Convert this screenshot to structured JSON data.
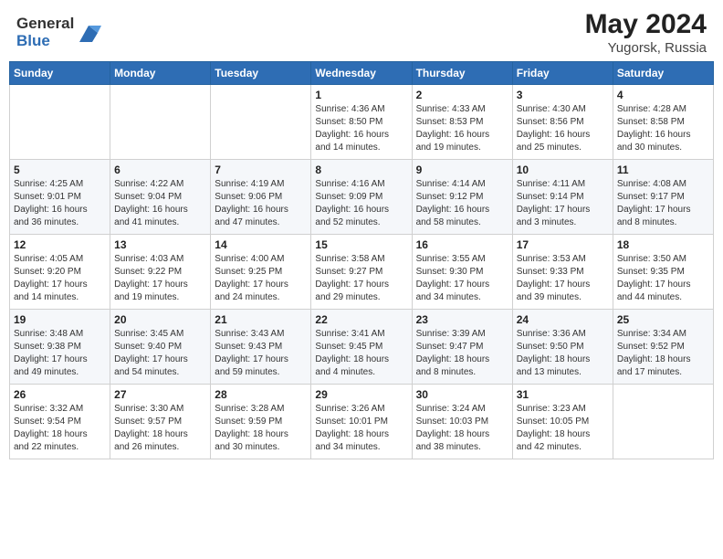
{
  "header": {
    "logo_general": "General",
    "logo_blue": "Blue",
    "title": "May 2024",
    "location": "Yugorsk, Russia"
  },
  "days_of_week": [
    "Sunday",
    "Monday",
    "Tuesday",
    "Wednesday",
    "Thursday",
    "Friday",
    "Saturday"
  ],
  "weeks": [
    [
      {
        "day": "",
        "info": ""
      },
      {
        "day": "",
        "info": ""
      },
      {
        "day": "",
        "info": ""
      },
      {
        "day": "1",
        "info": "Sunrise: 4:36 AM\nSunset: 8:50 PM\nDaylight: 16 hours\nand 14 minutes."
      },
      {
        "day": "2",
        "info": "Sunrise: 4:33 AM\nSunset: 8:53 PM\nDaylight: 16 hours\nand 19 minutes."
      },
      {
        "day": "3",
        "info": "Sunrise: 4:30 AM\nSunset: 8:56 PM\nDaylight: 16 hours\nand 25 minutes."
      },
      {
        "day": "4",
        "info": "Sunrise: 4:28 AM\nSunset: 8:58 PM\nDaylight: 16 hours\nand 30 minutes."
      }
    ],
    [
      {
        "day": "5",
        "info": "Sunrise: 4:25 AM\nSunset: 9:01 PM\nDaylight: 16 hours\nand 36 minutes."
      },
      {
        "day": "6",
        "info": "Sunrise: 4:22 AM\nSunset: 9:04 PM\nDaylight: 16 hours\nand 41 minutes."
      },
      {
        "day": "7",
        "info": "Sunrise: 4:19 AM\nSunset: 9:06 PM\nDaylight: 16 hours\nand 47 minutes."
      },
      {
        "day": "8",
        "info": "Sunrise: 4:16 AM\nSunset: 9:09 PM\nDaylight: 16 hours\nand 52 minutes."
      },
      {
        "day": "9",
        "info": "Sunrise: 4:14 AM\nSunset: 9:12 PM\nDaylight: 16 hours\nand 58 minutes."
      },
      {
        "day": "10",
        "info": "Sunrise: 4:11 AM\nSunset: 9:14 PM\nDaylight: 17 hours\nand 3 minutes."
      },
      {
        "day": "11",
        "info": "Sunrise: 4:08 AM\nSunset: 9:17 PM\nDaylight: 17 hours\nand 8 minutes."
      }
    ],
    [
      {
        "day": "12",
        "info": "Sunrise: 4:05 AM\nSunset: 9:20 PM\nDaylight: 17 hours\nand 14 minutes."
      },
      {
        "day": "13",
        "info": "Sunrise: 4:03 AM\nSunset: 9:22 PM\nDaylight: 17 hours\nand 19 minutes."
      },
      {
        "day": "14",
        "info": "Sunrise: 4:00 AM\nSunset: 9:25 PM\nDaylight: 17 hours\nand 24 minutes."
      },
      {
        "day": "15",
        "info": "Sunrise: 3:58 AM\nSunset: 9:27 PM\nDaylight: 17 hours\nand 29 minutes."
      },
      {
        "day": "16",
        "info": "Sunrise: 3:55 AM\nSunset: 9:30 PM\nDaylight: 17 hours\nand 34 minutes."
      },
      {
        "day": "17",
        "info": "Sunrise: 3:53 AM\nSunset: 9:33 PM\nDaylight: 17 hours\nand 39 minutes."
      },
      {
        "day": "18",
        "info": "Sunrise: 3:50 AM\nSunset: 9:35 PM\nDaylight: 17 hours\nand 44 minutes."
      }
    ],
    [
      {
        "day": "19",
        "info": "Sunrise: 3:48 AM\nSunset: 9:38 PM\nDaylight: 17 hours\nand 49 minutes."
      },
      {
        "day": "20",
        "info": "Sunrise: 3:45 AM\nSunset: 9:40 PM\nDaylight: 17 hours\nand 54 minutes."
      },
      {
        "day": "21",
        "info": "Sunrise: 3:43 AM\nSunset: 9:43 PM\nDaylight: 17 hours\nand 59 minutes."
      },
      {
        "day": "22",
        "info": "Sunrise: 3:41 AM\nSunset: 9:45 PM\nDaylight: 18 hours\nand 4 minutes."
      },
      {
        "day": "23",
        "info": "Sunrise: 3:39 AM\nSunset: 9:47 PM\nDaylight: 18 hours\nand 8 minutes."
      },
      {
        "day": "24",
        "info": "Sunrise: 3:36 AM\nSunset: 9:50 PM\nDaylight: 18 hours\nand 13 minutes."
      },
      {
        "day": "25",
        "info": "Sunrise: 3:34 AM\nSunset: 9:52 PM\nDaylight: 18 hours\nand 17 minutes."
      }
    ],
    [
      {
        "day": "26",
        "info": "Sunrise: 3:32 AM\nSunset: 9:54 PM\nDaylight: 18 hours\nand 22 minutes."
      },
      {
        "day": "27",
        "info": "Sunrise: 3:30 AM\nSunset: 9:57 PM\nDaylight: 18 hours\nand 26 minutes."
      },
      {
        "day": "28",
        "info": "Sunrise: 3:28 AM\nSunset: 9:59 PM\nDaylight: 18 hours\nand 30 minutes."
      },
      {
        "day": "29",
        "info": "Sunrise: 3:26 AM\nSunset: 10:01 PM\nDaylight: 18 hours\nand 34 minutes."
      },
      {
        "day": "30",
        "info": "Sunrise: 3:24 AM\nSunset: 10:03 PM\nDaylight: 18 hours\nand 38 minutes."
      },
      {
        "day": "31",
        "info": "Sunrise: 3:23 AM\nSunset: 10:05 PM\nDaylight: 18 hours\nand 42 minutes."
      },
      {
        "day": "",
        "info": ""
      }
    ]
  ]
}
